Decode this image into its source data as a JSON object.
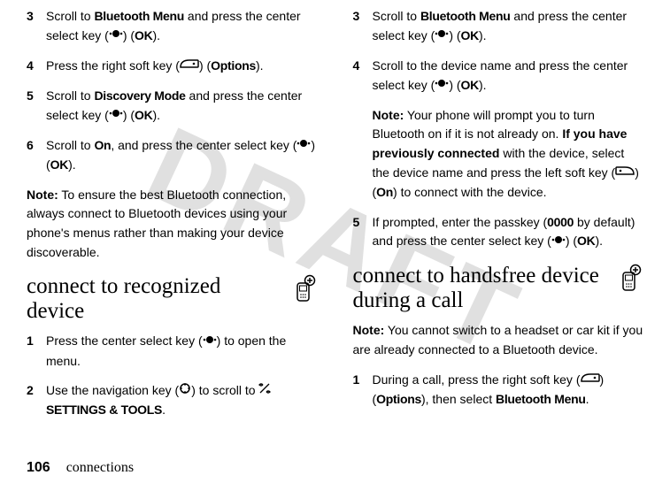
{
  "watermark": "DRAFT",
  "left": {
    "step3": {
      "num": "3",
      "pre": "Scroll to ",
      "bold1": "Bluetooth Menu",
      "mid": " and press the center select key (",
      "postIcon": ") (",
      "ok": "OK",
      "end": ")."
    },
    "step4": {
      "num": "4",
      "pre": "Press the right soft key (",
      "postIcon": ") (",
      "options": "Options",
      "end": ")."
    },
    "step5": {
      "num": "5",
      "pre": "Scroll to ",
      "bold1": "Discovery Mode",
      "mid": " and press the center select key (",
      "postIcon": ") (",
      "ok": "OK",
      "end": ")."
    },
    "step6": {
      "num": "6",
      "pre": "Scroll to ",
      "bold1": "On",
      "mid": ", and press the center select key (",
      "postIcon": ") (",
      "ok": "OK",
      "end": ")."
    },
    "note": {
      "label": "Note:",
      "text": " To ensure the best Bluetooth connection, always connect to Bluetooth devices using your phone's menus rather than making your device discoverable."
    },
    "heading": "connect to recognized device",
    "sub1": {
      "num": "1",
      "pre": "Press the center select key (",
      "postIcon": ") to open the menu."
    },
    "sub2": {
      "num": "2",
      "pre": "Use the navigation key (",
      "postIcon": ") to scroll to ",
      "tools": "SETTINGS & TOOLS",
      "end": "."
    }
  },
  "right": {
    "step3": {
      "num": "3",
      "pre": "Scroll to ",
      "bold1": "Bluetooth Menu",
      "mid": " and press the center select key (",
      "postIcon": ") (",
      "ok": "OK",
      "end": ")."
    },
    "step4": {
      "num": "4",
      "pre": "Scroll to the device name and press the center select key (",
      "postIcon": ") (",
      "ok": "OK",
      "end": ")."
    },
    "note1": {
      "label": "Note:",
      "text1": " Your phone will prompt you to turn Bluetooth on if it is not already on. ",
      "bold": "If you have previously connected",
      "text2": " with the device, select the device name and press the left soft key (",
      "postIcon": ") (",
      "on": "On",
      "end": ") to connect with the device."
    },
    "step5": {
      "num": "5",
      "pre": "If prompted, enter the passkey (",
      "passkey": "0000",
      "mid": " by default) and press the center select key (",
      "postIcon": ") (",
      "ok": "OK",
      "end": ")."
    },
    "heading": "connect to handsfree device during a call",
    "note2": {
      "label": "Note:",
      "text": " You cannot switch to a headset or car kit if you are already connected to a Bluetooth device."
    },
    "sub1": {
      "num": "1",
      "pre": "During a call, press the right soft key (",
      "postIcon": ") (",
      "options": "Options",
      "mid": "), then select ",
      "btmenu": "Bluetooth Menu",
      "end": "."
    }
  },
  "footer": {
    "page": "106",
    "section": "connections"
  }
}
